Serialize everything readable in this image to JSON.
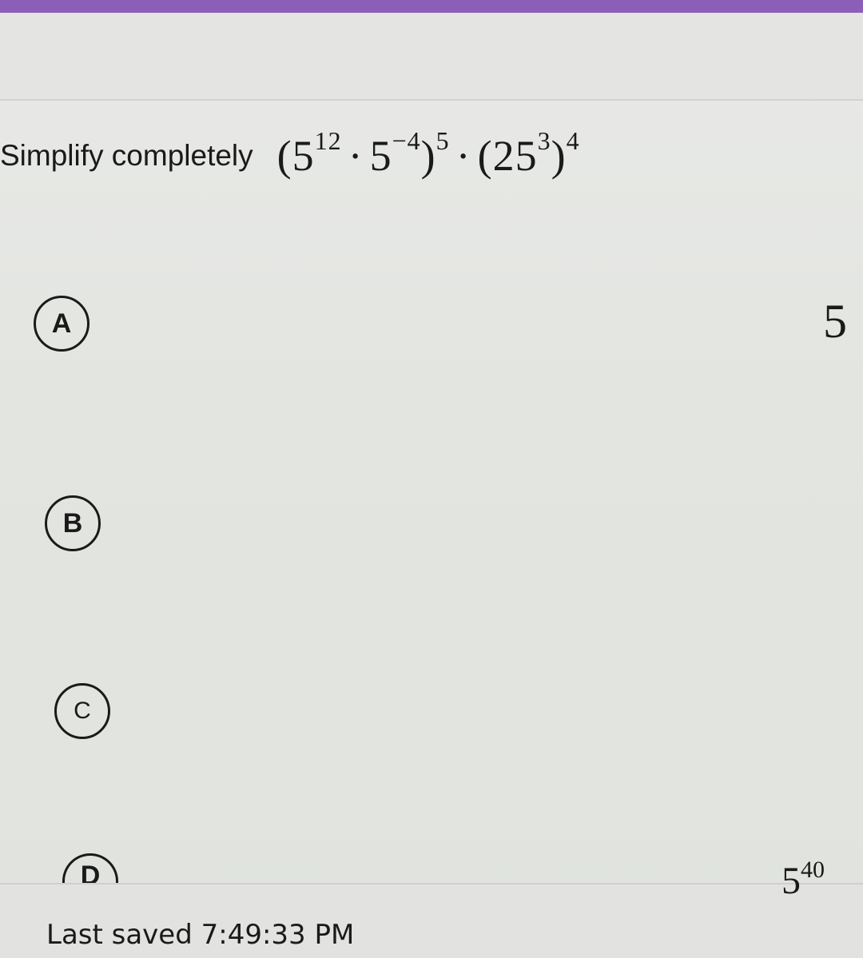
{
  "question": {
    "prompt": "Simplify completely",
    "expression": {
      "open1": "(",
      "base1": "5",
      "exp1": "12",
      "dot1": "·",
      "base2": "5",
      "exp2": "−4",
      "close1": ")",
      "outer_exp1": "5",
      "dot2": "·",
      "open2": "(",
      "base3": "25",
      "exp3": "3",
      "close2": ")",
      "outer_exp2": "4"
    }
  },
  "options": [
    {
      "letter": "A",
      "answer_base": "5",
      "answer_exp": ""
    },
    {
      "letter": "B",
      "answer_base": "",
      "answer_exp": ""
    },
    {
      "letter": "C",
      "answer_base": "",
      "answer_exp": ""
    },
    {
      "letter": "D",
      "answer_base": "5",
      "answer_exp": "40"
    }
  ],
  "footer": {
    "last_saved": "Last saved 7:49:33 PM"
  },
  "colors": {
    "accent_top_bar": "#8b5fb8",
    "text": "#1a1a1a",
    "background": "#e4e5e2"
  }
}
